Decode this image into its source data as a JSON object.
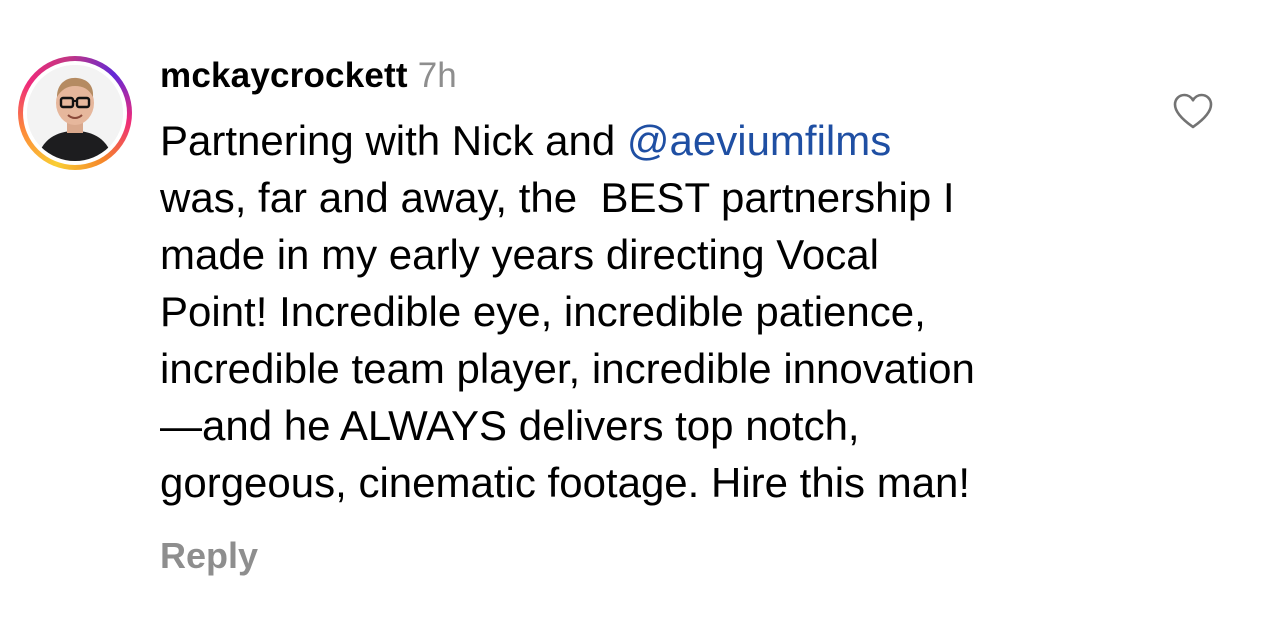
{
  "comment": {
    "username": "mckaycrockett",
    "timestamp": "7h",
    "mention": "@aeviumfilms",
    "lines": [
      "Partnering with Nick and ",
      "was, far and away, the  BEST partnership I",
      "made in my early years directing Vocal",
      "Point! Incredible eye, incredible patience,",
      "incredible team player, incredible innovation",
      "—and he ALWAYS delivers top notch,",
      "gorgeous, cinematic footage. Hire this man!"
    ],
    "reply_label": "Reply",
    "like_icon": "heart-outline-icon"
  },
  "colors": {
    "username": "#000000",
    "muted": "#8e8e8e",
    "mention": "#1f4fa3"
  }
}
